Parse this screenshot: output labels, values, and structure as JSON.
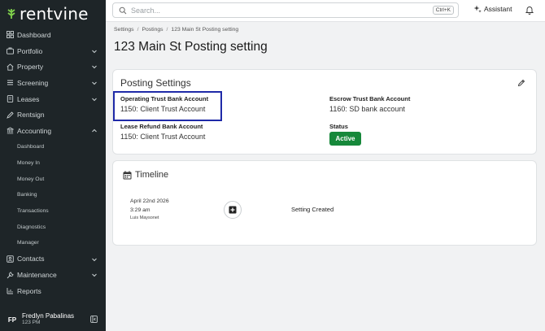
{
  "brand": {
    "name": "rentvine",
    "color": "#1e2528"
  },
  "sidebar": {
    "items": [
      {
        "label": "Dashboard",
        "icon": "dashboard-icon",
        "chevron": false
      },
      {
        "label": "Portfolio",
        "icon": "portfolio-icon",
        "chevron": true
      },
      {
        "label": "Property",
        "icon": "property-icon",
        "chevron": true
      },
      {
        "label": "Screening",
        "icon": "screening-icon",
        "chevron": true
      },
      {
        "label": "Leases",
        "icon": "leases-icon",
        "chevron": true
      },
      {
        "label": "Rentsign",
        "icon": "rentsign-icon",
        "chevron": false
      },
      {
        "label": "Accounting",
        "icon": "accounting-icon",
        "chevron": true
      }
    ],
    "accounting_sub": [
      "Dashboard",
      "Money In",
      "Money Out",
      "Banking",
      "Transactions",
      "Diagnostics",
      "Manager"
    ],
    "items_after": [
      {
        "label": "Contacts",
        "icon": "contacts-icon",
        "chevron": true
      },
      {
        "label": "Maintenance",
        "icon": "maintenance-icon",
        "chevron": true
      },
      {
        "label": "Reports",
        "icon": "reports-icon",
        "chevron": false
      }
    ],
    "user": {
      "initials": "FP",
      "name": "Fredlyn Pabalinas",
      "sub": "123 PM"
    }
  },
  "topbar": {
    "search_placeholder": "Search...",
    "shortcut": "Ctrl+K",
    "assistant_label": "Assistant"
  },
  "breadcrumb": [
    "Settings",
    "Postings",
    "123 Main St Posting setting"
  ],
  "page_title": "123 Main St Posting setting",
  "posting_settings": {
    "title": "Posting Settings",
    "operating_label": "Operating Trust Bank Account",
    "operating_value": "1150: Client Trust Account",
    "escrow_label": "Escrow Trust Bank Account",
    "escrow_value": "1160: SD bank account",
    "lease_refund_label": "Lease Refund Bank Account",
    "lease_refund_value": "1150: Client Trust Account",
    "status_label": "Status",
    "status_value": "Active",
    "status_color": "#16883a",
    "highlight_color": "#1f2aa8"
  },
  "timeline": {
    "title": "Timeline",
    "entries": [
      {
        "date": "April 22nd 2026",
        "time": "3:29 am",
        "user": "Luis Maysonet",
        "event": "Setting Created"
      }
    ]
  }
}
